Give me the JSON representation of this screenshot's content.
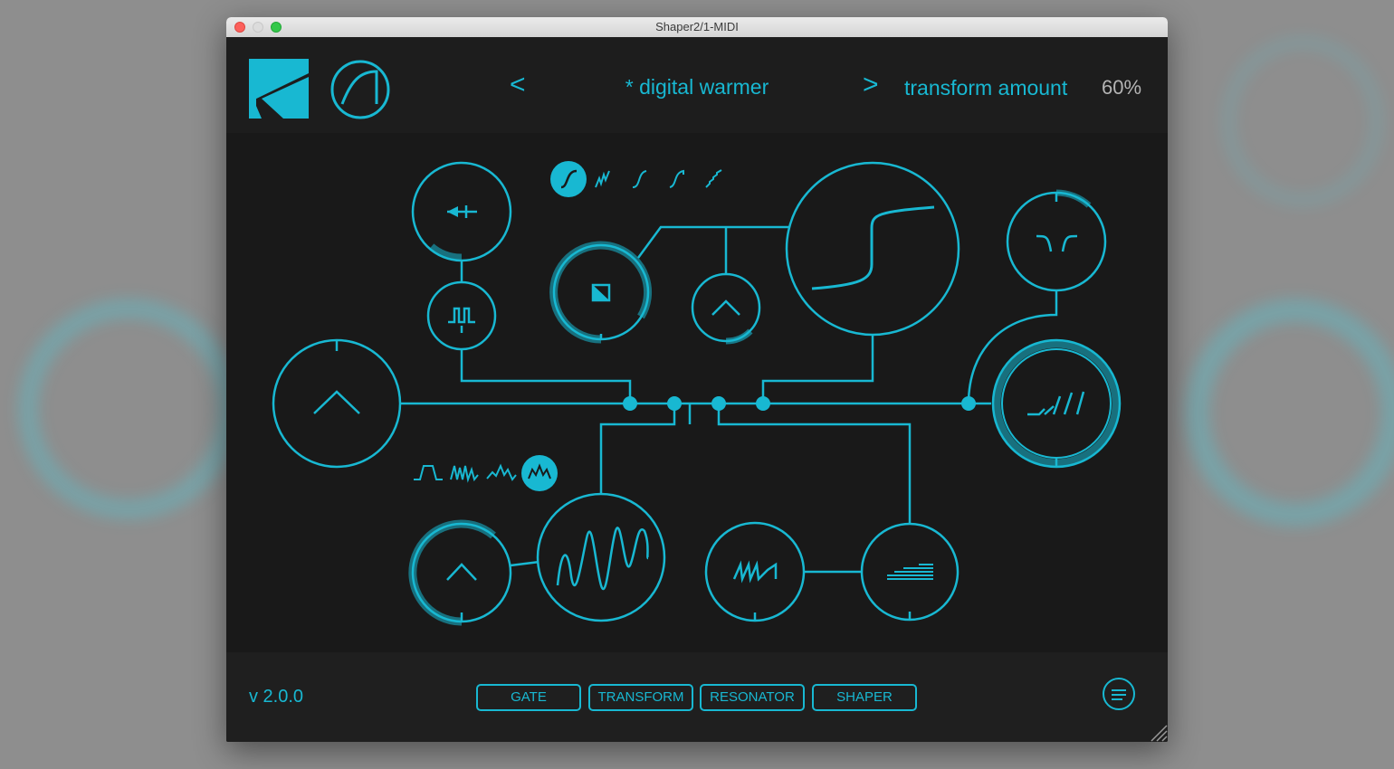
{
  "window": {
    "title": "Shaper2/1-MIDI"
  },
  "header": {
    "prev_label": "<",
    "next_label": ">",
    "preset_name": "* digital warmer",
    "param_name": "transform amount",
    "param_value": "60%"
  },
  "shaper_curve_selector": {
    "options": [
      "s-curve-icon",
      "noise-curve-icon",
      "soft-curve-icon",
      "hard-curve-icon",
      "stair-curve-icon"
    ],
    "selected_index": 0
  },
  "wave_selector": {
    "options": [
      "pulse-wave-icon",
      "noise-wave-icon",
      "zigzag-wave-icon",
      "peak-wave-icon"
    ],
    "selected_index": 3
  },
  "modules": [
    {
      "name": "input-knob",
      "icon": "chevron-up-icon",
      "value": 0.5
    },
    {
      "name": "gate-threshold-knob",
      "icon": "arrow-left-icon",
      "value": 0.12
    },
    {
      "name": "gate-pulse-knob",
      "icon": "pulse-icon",
      "value": 0.0
    },
    {
      "name": "transform-knob",
      "icon": "square-half-icon",
      "value": 0.6
    },
    {
      "name": "shaper-drive-knob",
      "icon": "chevron-up-icon",
      "value": 0.28
    },
    {
      "name": "shaper-curve-display",
      "icon": "s-curve-icon"
    },
    {
      "name": "resonator-filter-knob",
      "icon": "notch-filter-icon",
      "value": 0.1
    },
    {
      "name": "output-knob",
      "icon": "ramp-icon",
      "value": 1.0
    },
    {
      "name": "lfo-amount-knob",
      "icon": "chevron-up-icon",
      "value": 0.75
    },
    {
      "name": "lfo-wave-display",
      "icon": "sine-wave-icon"
    },
    {
      "name": "sawtooth-knob",
      "icon": "sawtooth-icon",
      "value": 0.0
    },
    {
      "name": "steps-knob",
      "icon": "steps-icon",
      "value": 0.0
    }
  ],
  "footer": {
    "version": "v 2.0.0",
    "tabs": [
      "GATE",
      "TRANSFORM",
      "RESONATOR",
      "SHAPER"
    ]
  },
  "colors": {
    "accent": "#18b8d2",
    "background": "#191919",
    "panel": "#1f1f1f"
  }
}
